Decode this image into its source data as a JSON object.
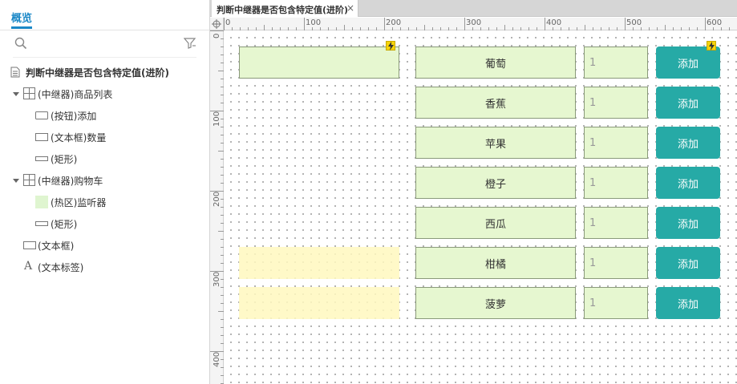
{
  "left_panel": {
    "tab_label": "概览",
    "tree": [
      {
        "label": "判断中继器是否包含特定值(进阶)",
        "bold": true
      },
      {
        "label": "(中继器)商品列表"
      },
      {
        "label": "(按钮)添加"
      },
      {
        "label": "(文本框)数量"
      },
      {
        "label": "(矩形)"
      },
      {
        "label": "(中继器)购物车"
      },
      {
        "label": "(热区)监听器"
      },
      {
        "label": "(矩形)"
      },
      {
        "label": "(文本框)"
      },
      {
        "label": "(文本标签)"
      }
    ]
  },
  "doc_tab": {
    "title": "判断中继器是否包含特定值(进阶)",
    "close": "×"
  },
  "ruler": {
    "h": [
      "0",
      "100",
      "200",
      "300",
      "400",
      "500",
      "600"
    ],
    "v": [
      "0",
      "100",
      "200",
      "300",
      "400"
    ]
  },
  "products": [
    {
      "name": "葡萄",
      "qty": "1",
      "button": "添加"
    },
    {
      "name": "香蕉",
      "qty": "1",
      "button": "添加"
    },
    {
      "name": "苹果",
      "qty": "1",
      "button": "添加"
    },
    {
      "name": "橙子",
      "qty": "1",
      "button": "添加"
    },
    {
      "name": "西瓜",
      "qty": "1",
      "button": "添加"
    },
    {
      "name": "柑橘",
      "qty": "1",
      "button": "添加"
    },
    {
      "name": "菠萝",
      "qty": "1",
      "button": "添加"
    }
  ],
  "colors": {
    "accent": "#1b88c7",
    "button": "#26aaa6",
    "widget_fill": "#e6f7d0",
    "hotspot": "#fff8be"
  }
}
